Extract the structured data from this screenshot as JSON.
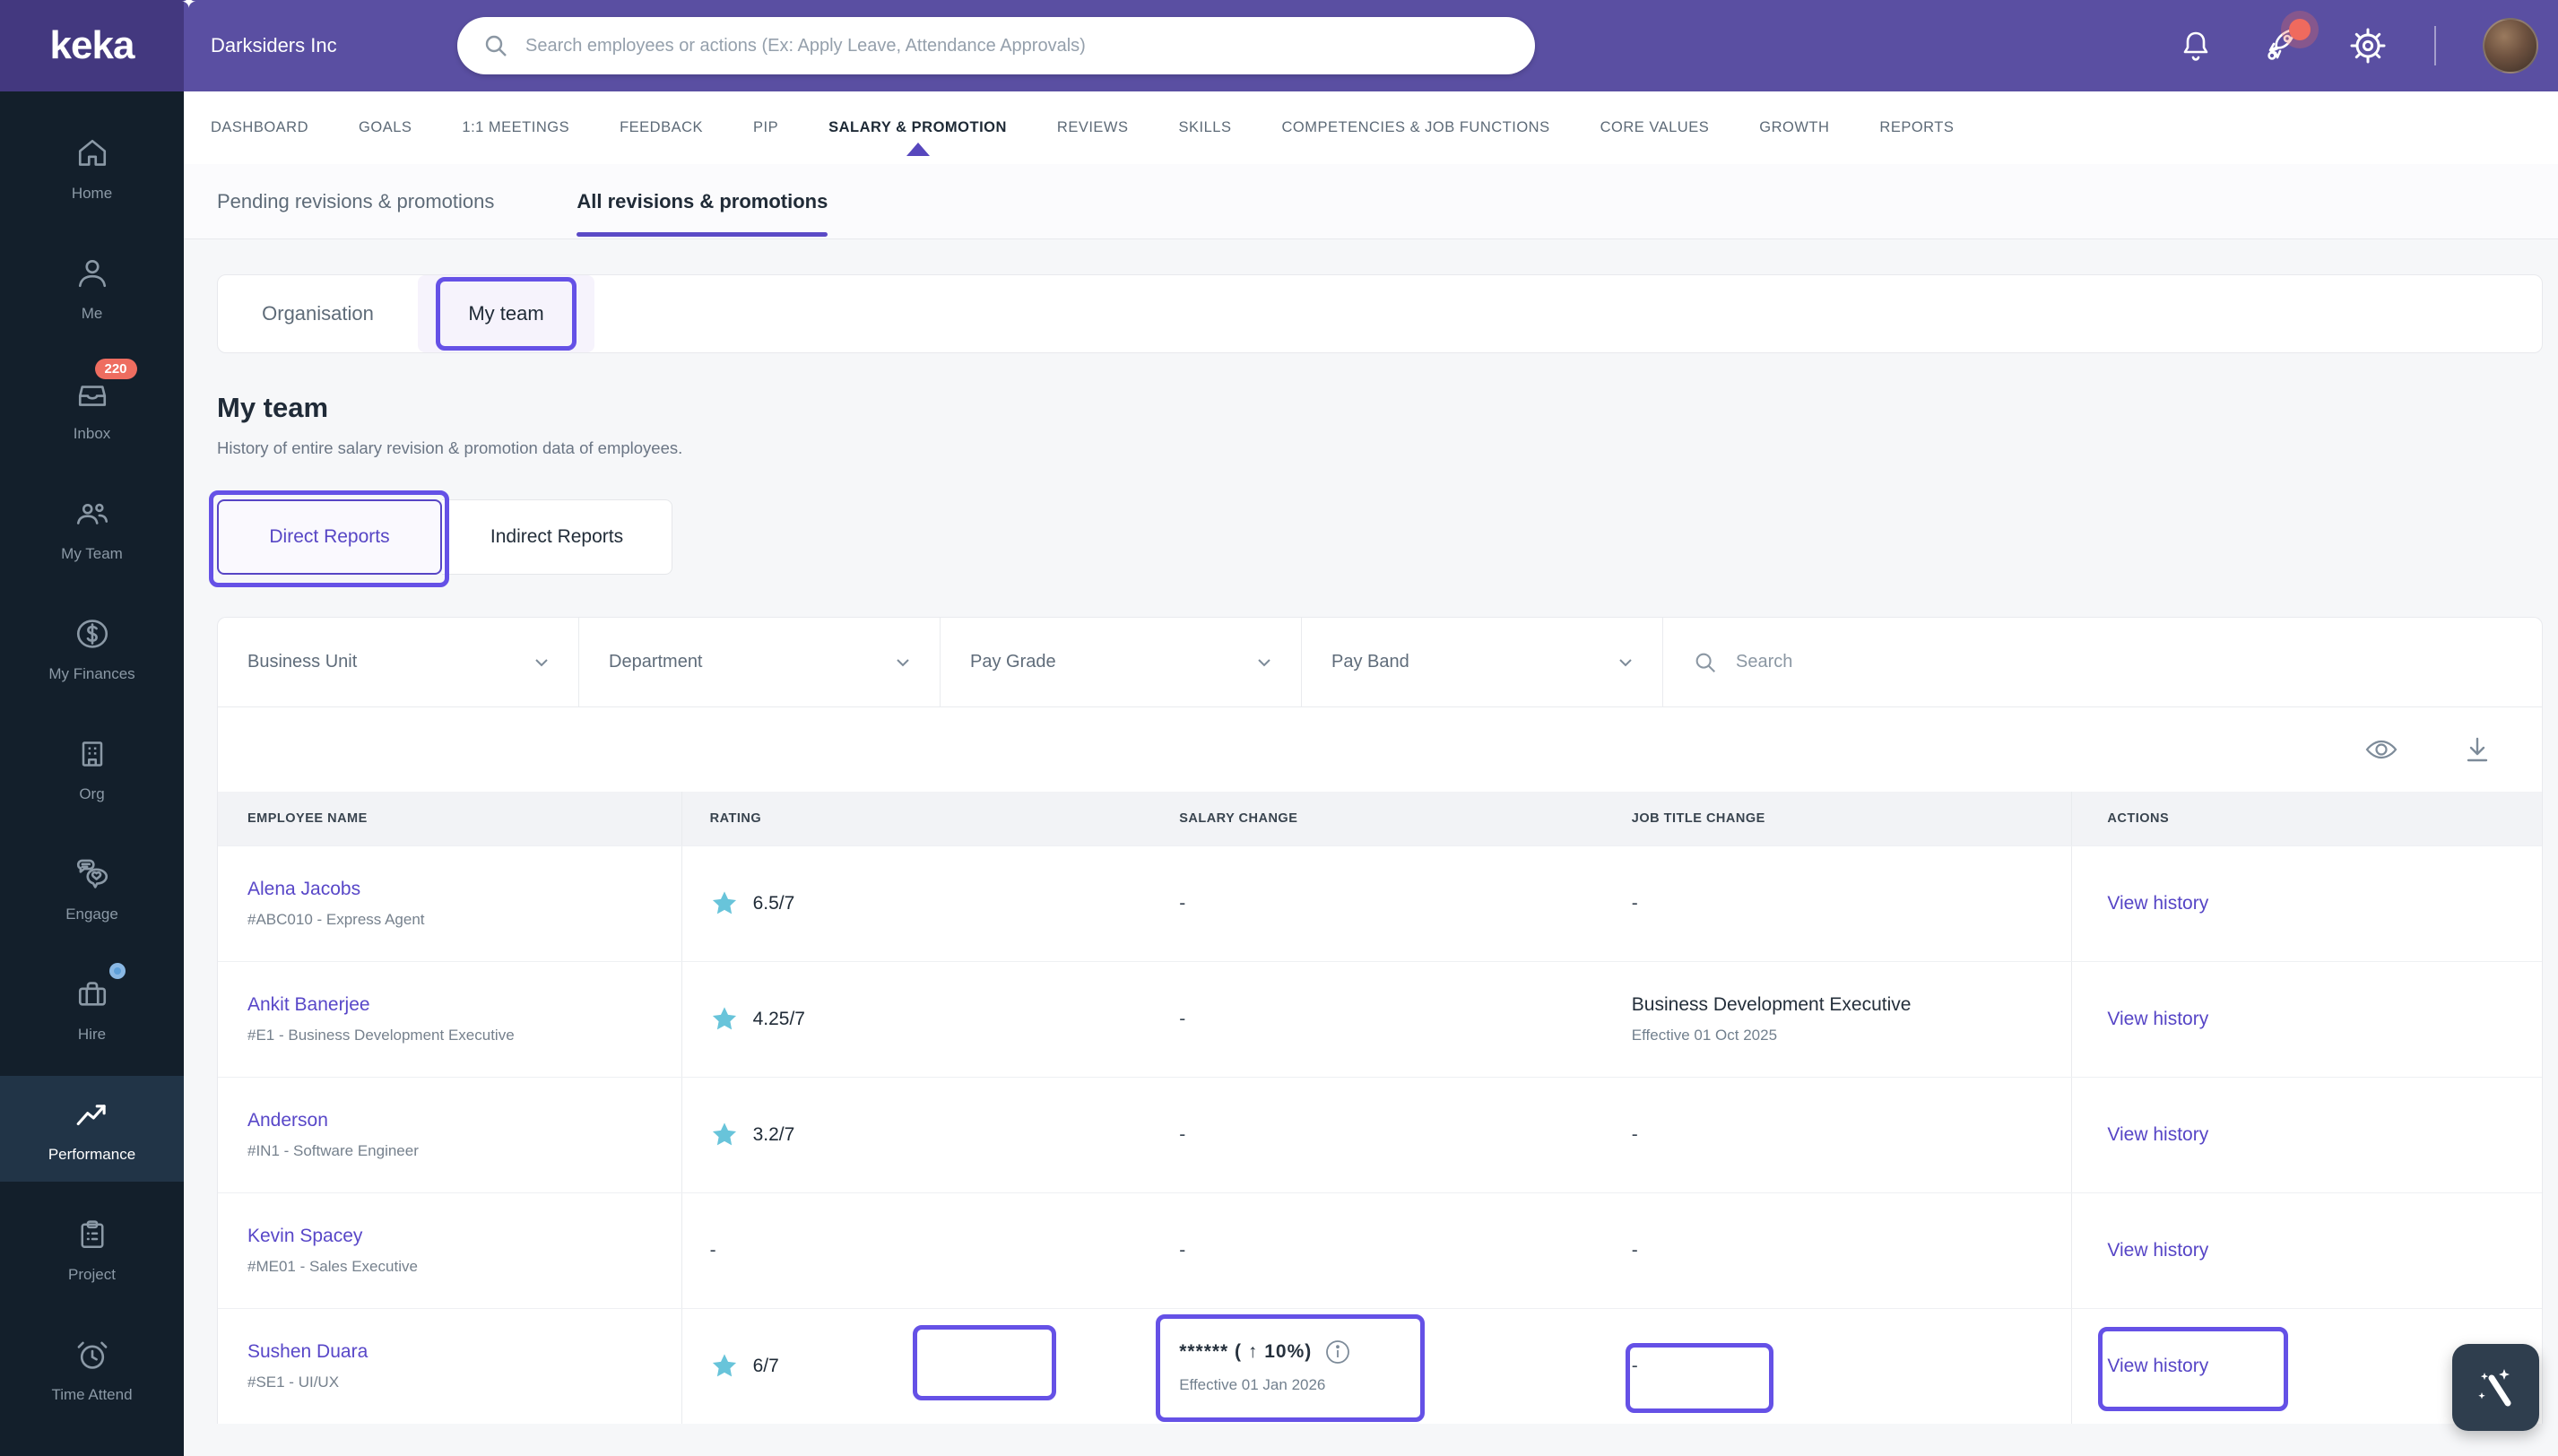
{
  "topbar": {
    "logo": "keka",
    "company": "Darksiders Inc",
    "search_placeholder": "Search employees or actions (Ex: Apply Leave, Attendance Approvals)"
  },
  "sidebar": {
    "items": [
      {
        "label": "Home"
      },
      {
        "label": "Me"
      },
      {
        "label": "Inbox",
        "badge": "220"
      },
      {
        "label": "My Team"
      },
      {
        "label": "My Finances"
      },
      {
        "label": "Org"
      },
      {
        "label": "Engage"
      },
      {
        "label": "Hire"
      },
      {
        "label": "Performance"
      },
      {
        "label": "Project"
      },
      {
        "label": "Time Attend"
      }
    ]
  },
  "nav": {
    "items": [
      "DASHBOARD",
      "GOALS",
      "1:1 MEETINGS",
      "FEEDBACK",
      "PIP",
      "SALARY & PROMOTION",
      "REVIEWS",
      "SKILLS",
      "COMPETENCIES & JOB FUNCTIONS",
      "CORE VALUES",
      "GROWTH",
      "REPORTS"
    ],
    "active": "SALARY & PROMOTION"
  },
  "subtabs": {
    "pending": "Pending revisions & promotions",
    "all": "All revisions & promotions"
  },
  "view_toggle": {
    "organisation": "Organisation",
    "my_team": "My team"
  },
  "heading": {
    "title": "My team",
    "subtitle": "History of entire salary revision & promotion data of employees."
  },
  "report_buttons": {
    "direct": "Direct Reports",
    "indirect": "Indirect Reports"
  },
  "filters": {
    "business_unit": "Business Unit",
    "department": "Department",
    "pay_grade": "Pay Grade",
    "pay_band": "Pay Band",
    "search_placeholder": "Search"
  },
  "table": {
    "headers": {
      "employee": "EMPLOYEE NAME",
      "rating": "RATING",
      "salary": "SALARY CHANGE",
      "job": "JOB TITLE CHANGE",
      "actions": "ACTIONS"
    },
    "rows": [
      {
        "name": "Alena Jacobs",
        "code": "#ABC010 - Express Agent",
        "rating": "6.5/7",
        "salary": "-",
        "job": "-",
        "action": "View history"
      },
      {
        "name": "Ankit Banerjee",
        "code": "#E1 - Business Development Executive",
        "rating": "4.25/7",
        "salary": "-",
        "job": "Business Development Executive",
        "job_effective": "Effective 01 Oct 2025",
        "action": "View history"
      },
      {
        "name": "Anderson",
        "code": "#IN1 - Software Engineer",
        "rating": "3.2/7",
        "salary": "-",
        "job": "-",
        "action": "View history"
      },
      {
        "name": "Kevin Spacey",
        "code": "#ME01 - Sales Executive",
        "rating": "-",
        "salary": "-",
        "job": "-",
        "action": "View history"
      },
      {
        "name": "Sushen Duara",
        "code": "#SE1 - UI/UX",
        "rating": "6/7",
        "salary": "****** ( ↑ 10%)",
        "salary_effective": "Effective 01 Jan 2026",
        "job": "-",
        "action": "View history"
      }
    ]
  },
  "colors": {
    "topbar_purple": "#5a4fa2",
    "logo_block_purple": "#43387f",
    "sidebar_navy": "#131f2b",
    "annotation_purple": "#6551e6",
    "link_purple": "#5847c8",
    "star_teal": "#68c4da",
    "badge_red": "#ee6d60"
  }
}
